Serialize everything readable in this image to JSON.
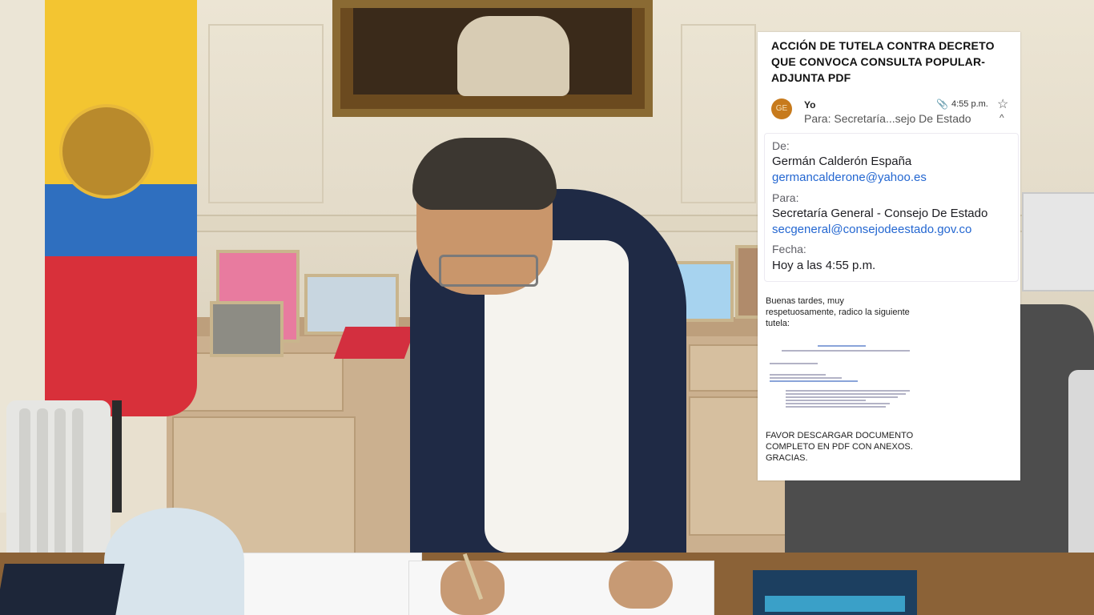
{
  "email": {
    "subject": "ACCIÓN DE TUTELA CONTRA DECRETO QUE CONVOCA CONSULTA POPULAR- ADJUNTA PDF",
    "avatar_initials": "GE",
    "sender_short": "Yo",
    "time": "4:55 p.m.",
    "to_summary": "Para: Secretaría...sejo De Estado",
    "icons": {
      "attachment": "paperclip-icon",
      "star": "star-icon",
      "collapse": "chevron-up-icon"
    },
    "details": {
      "from_label": "De:",
      "from_name": "Germán Calderón España",
      "from_email": "germancalderone@yahoo.es",
      "to_label": "Para:",
      "to_name": "Secretaría General - Consejo De Estado",
      "to_email": "secgeneral@consejodeestado.gov.co",
      "date_label": "Fecha:",
      "date_value": "Hoy a las 4:55 p.m."
    },
    "body_greeting": "Buenas tardes, muy respetuosamente, radico la siguiente tutela:",
    "body_footer": "FAVOR DESCARGAR DOCUMENTO COMPLETO EN PDF CON ANEXOS. GRACIAS."
  },
  "colors": {
    "avatar": "#c77a1c",
    "link": "#2467d1",
    "flag_yellow": "#f3c531",
    "flag_blue": "#2f6fbf",
    "flag_red": "#d8303a"
  }
}
